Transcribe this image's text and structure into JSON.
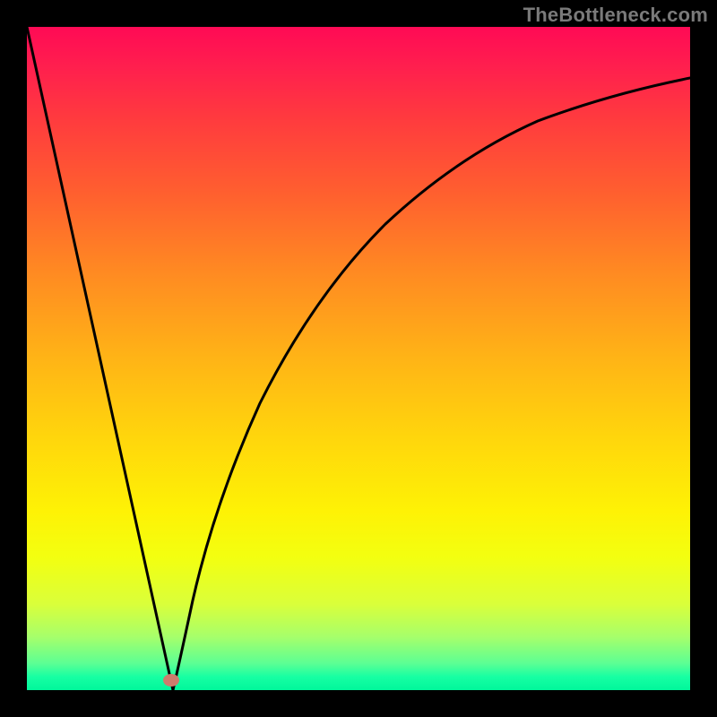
{
  "watermark": {
    "text": "TheBottleneck.com"
  },
  "colors": {
    "gradient_top": "#ff0a55",
    "gradient_mid_upper": "#ff8a22",
    "gradient_mid_lower": "#fef205",
    "gradient_bottom": "#00f79b",
    "frame": "#000000",
    "curve": "#000000",
    "marker": "#cd7c6d"
  },
  "chart_data": {
    "type": "line",
    "title": "",
    "xlabel": "",
    "ylabel": "",
    "xlim": [
      0,
      100
    ],
    "ylim": [
      0,
      100
    ],
    "grid": false,
    "legend": false,
    "series": [
      {
        "name": "left-line",
        "x": [
          0,
          22
        ],
        "values": [
          100,
          0
        ]
      },
      {
        "name": "right-curve",
        "x": [
          22,
          25,
          30,
          35,
          40,
          45,
          50,
          55,
          60,
          65,
          70,
          75,
          80,
          85,
          90,
          95,
          100
        ],
        "values": [
          0,
          14,
          31,
          45,
          55,
          63,
          69,
          74,
          78,
          81,
          84,
          86,
          88,
          89.5,
          90.7,
          91.6,
          92.3
        ]
      }
    ],
    "annotations": [
      {
        "name": "vertex-marker",
        "x": 22,
        "y": 1
      }
    ]
  }
}
